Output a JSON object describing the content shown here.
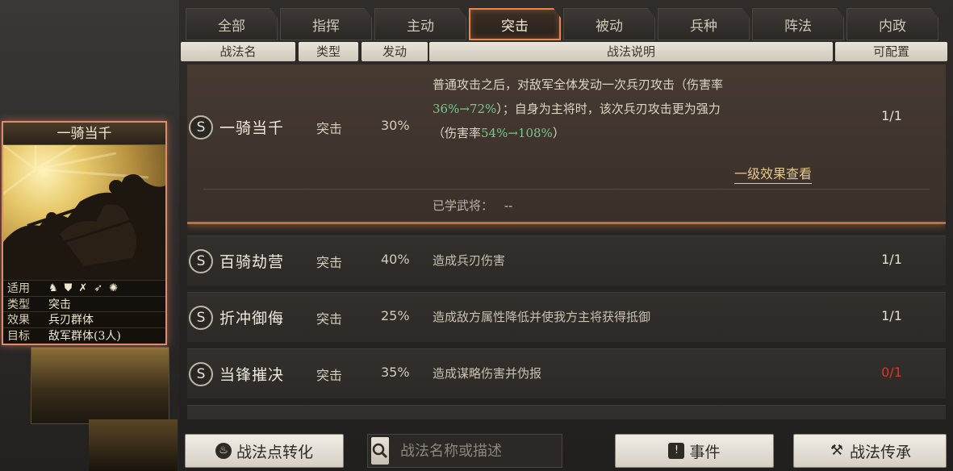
{
  "tabs": [
    {
      "label": "全部",
      "active": false
    },
    {
      "label": "指挥",
      "active": false
    },
    {
      "label": "主动",
      "active": false
    },
    {
      "label": "突击",
      "active": true
    },
    {
      "label": "被动",
      "active": false
    },
    {
      "label": "兵种",
      "active": false
    },
    {
      "label": "阵法",
      "active": false
    },
    {
      "label": "内政",
      "active": false
    }
  ],
  "columns": {
    "name": "战法名",
    "type": "类型",
    "rate": "发动",
    "desc": "战法说明",
    "avail": "可配置"
  },
  "card": {
    "title": "一骑当千",
    "applies_label": "适用",
    "applies_icons": [
      "cavalry-icon",
      "shield-icon",
      "bow-icon",
      "spear-icon",
      "chariot-icon"
    ],
    "type_label": "类型",
    "type_value": "突击",
    "effect_label": "效果",
    "effect_value": "兵刃群体",
    "target_label": "目标",
    "target_value": "敌军群体(3人)"
  },
  "selected": {
    "grade": "S",
    "name": "一骑当千",
    "type": "突击",
    "rate": "30%",
    "avail": "1/1",
    "desc_1": "普通攻击之后，对敌军全体发动一次兵刃攻击（伤害率",
    "desc_2_hl": "36%→72%",
    "desc_2_rest": "）；自身为主将时，该次兵刃攻击更为强力",
    "desc_3_pre": "（伤害率",
    "desc_3_hl": "54%→108%",
    "desc_3_post": "）",
    "level_link": "一级效果查看",
    "learned_label": "已学武将：",
    "learned_value": "--"
  },
  "rows": [
    {
      "grade": "S",
      "name": "百骑劫营",
      "type": "突击",
      "rate": "40%",
      "desc": "造成兵刃伤害",
      "avail": "1/1",
      "avail_red": false
    },
    {
      "grade": "S",
      "name": "折冲御侮",
      "type": "突击",
      "rate": "25%",
      "desc": "造成敌方属性降低并使我方主将获得抵御",
      "avail": "1/1",
      "avail_red": false
    },
    {
      "grade": "S",
      "name": "当锋摧决",
      "type": "突击",
      "rate": "35%",
      "desc": "造成谋略伤害并伪报",
      "avail": "0/1",
      "avail_red": true
    }
  ],
  "bottom": {
    "convert_label": "战法点转化",
    "search_placeholder": "战法名称或描述",
    "events_label": "事件",
    "inherit_label": "战法传承"
  },
  "colors": {
    "accent_orange": "#e8874a",
    "highlight_green": "#74c98a",
    "warning_red": "#d8382b",
    "link_gold": "#e6c88a"
  }
}
